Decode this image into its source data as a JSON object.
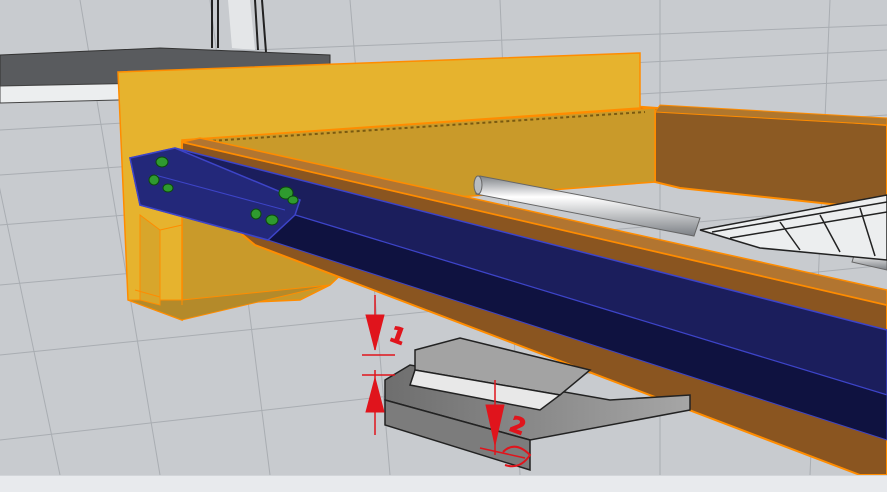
{
  "viewport": {
    "background_color": "#c8cbcf",
    "grid_color": "#a9adb2",
    "selection_color": "#ff8c00"
  },
  "model": {
    "end_plate_color": "#e6b32e",
    "side_plate_color": "#c99a2a",
    "main_beam_color": "#8a5520",
    "steel_beam_color": "#1b1e5c",
    "bolt_color": "#2f9a2f",
    "pipe_color": "#d5d8dc",
    "base_block_color": "#8f8f8f"
  },
  "dimensions": [
    {
      "name": "dimension-1",
      "text": "1"
    },
    {
      "name": "dimension-2",
      "text": "2"
    }
  ]
}
